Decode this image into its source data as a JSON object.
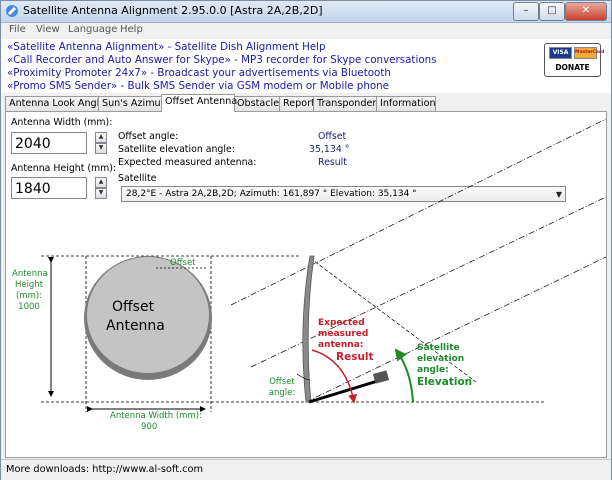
{
  "window": {
    "title": "Satellite Antenna Alignment 2.95.0.0 [Astra 2A,2B,2D]",
    "min_glyph": "–",
    "max_glyph": "□",
    "close_glyph": "✕"
  },
  "menu": [
    "File",
    "View",
    "Language",
    "Help"
  ],
  "ads": [
    "«Satellite Antenna Alignment» - Satellite Dish Alignment Help",
    "«Call Recorder and Auto Answer for Skype» - MP3 recorder for Skype conversations",
    "«Proximity Promoter 24x7» - Broadcast your advertisements via Bluetooth",
    "«Promo SMS Sender» - Bulk SMS Sender via GSM modem or Mobile phone"
  ],
  "donate": {
    "visa": "VISA",
    "mastercard": "MasterCard",
    "label": "DONATE"
  },
  "tabs": [
    "Antenna Look Angles",
    "Sun's Azimuth",
    "Offset Antenna",
    "Obstacles",
    "Report",
    "Transponders",
    "Information"
  ],
  "active_tab": "Offset Antenna",
  "form": {
    "width_label": "Antenna Width (mm):",
    "width_value": "2040",
    "height_label": "Antenna Height (mm):",
    "height_value": "1840",
    "offset_angle_label": "Offset angle:",
    "offset_angle_value": "Offset",
    "elevation_label": "Satellite elevation angle:",
    "elevation_value": "35,134 °",
    "measured_label": "Expected measured antenna:",
    "measured_value": "Result",
    "satellite_label": "Satellite",
    "satellite_value": "28,2°E - Astra 2A,2B,2D;  Azimuth: 161,897 °  Elevation: 35,134 °",
    "spin_up": "▲",
    "spin_down": "▼",
    "combo_arrow": "▼"
  },
  "diagram": {
    "antenna_title_1": "Offset",
    "antenna_title_2": "Antenna",
    "height_caption": [
      "Antenna",
      "Height",
      "(mm):",
      "1000"
    ],
    "width_caption": "Antenna Width (mm):",
    "width_value": "900",
    "offset_top": "Offset",
    "offset_angle": [
      "Offset",
      "angle:"
    ],
    "expected": [
      "Expected",
      "measured",
      "antenna:"
    ],
    "result": "Result",
    "sat_elev": [
      "Satellite",
      "elevation",
      "angle:"
    ],
    "elevation": "Elevation",
    "colors": {
      "result": "#c8202a",
      "elevation": "#1f8a2a",
      "dish": "#c4c4c4"
    }
  },
  "status": "More downloads: http://www.al-soft.com"
}
